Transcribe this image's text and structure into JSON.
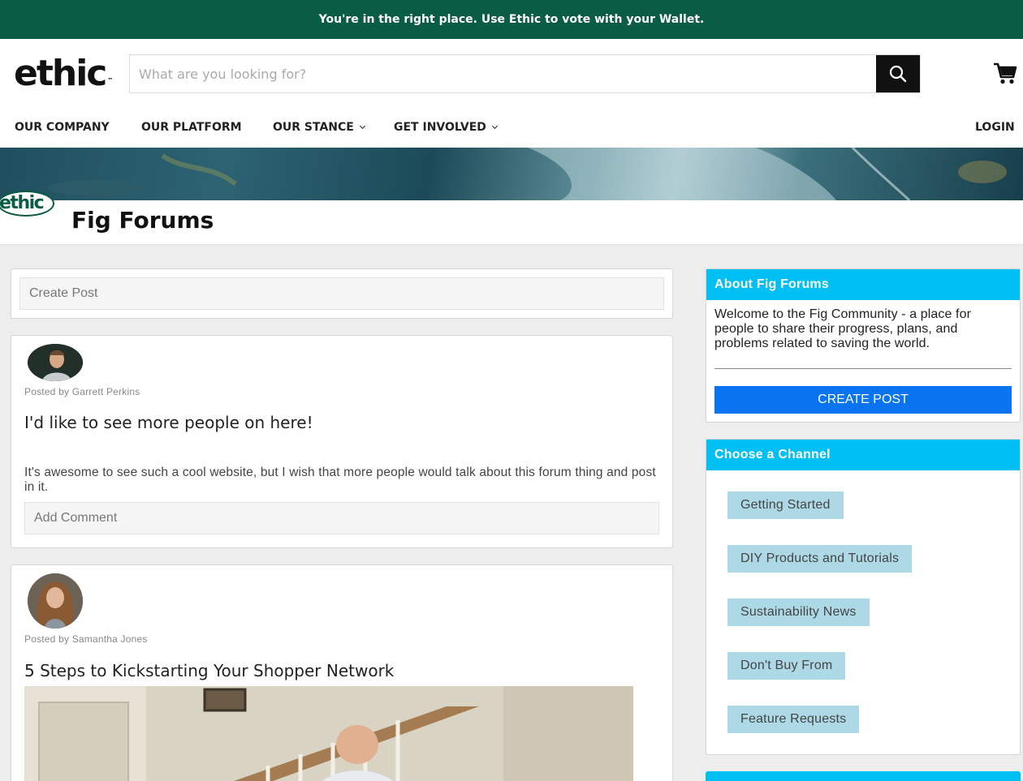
{
  "announcement": "You're in the right place. Use Ethic to vote with your Wallet.",
  "header": {
    "logo": "ethic",
    "logo_mark": "™",
    "search_placeholder": "What are you looking for?"
  },
  "nav": {
    "items": [
      {
        "label": "OUR COMPANY",
        "dropdown": false
      },
      {
        "label": "OUR PLATFORM",
        "dropdown": false
      },
      {
        "label": "OUR STANCE",
        "dropdown": true
      },
      {
        "label": "GET INVOLVED",
        "dropdown": true
      }
    ],
    "login": "LOGIN"
  },
  "forum": {
    "logo_text": "ethic",
    "title": "Fig Forums"
  },
  "create_post_placeholder": "Create Post",
  "posts": [
    {
      "author": "Posted by Garrett Perkins",
      "title": "I'd like to see more people on here!",
      "body": "It's awesome to see such a cool website, but I wish that more people would talk about this forum thing and post in it.",
      "comment_placeholder": "Add Comment"
    },
    {
      "author": "Posted by Samantha Jones",
      "title": "5 Steps to Kickstarting Your Shopper Network"
    }
  ],
  "sidebar": {
    "about": {
      "title": "About Fig Forums",
      "text": "Welcome to the Fig Community - a place for people to share their progress, plans, and problems related to saving the world.",
      "button": "CREATE POST"
    },
    "channels": {
      "title": "Choose a Channel",
      "items": [
        "Getting Started",
        "DIY Products and Tutorials",
        "Sustainability News",
        "Don't Buy From",
        "Feature Requests"
      ]
    }
  },
  "colors": {
    "announcement_bg": "#0b5c45",
    "sidebar_header": "#00bff3",
    "primary_button": "#0a74f0",
    "channel_chip": "#add8e6"
  },
  "icons": {
    "search": "search-icon",
    "cart": "cart-icon",
    "dropdown": "chevron-down-icon"
  }
}
